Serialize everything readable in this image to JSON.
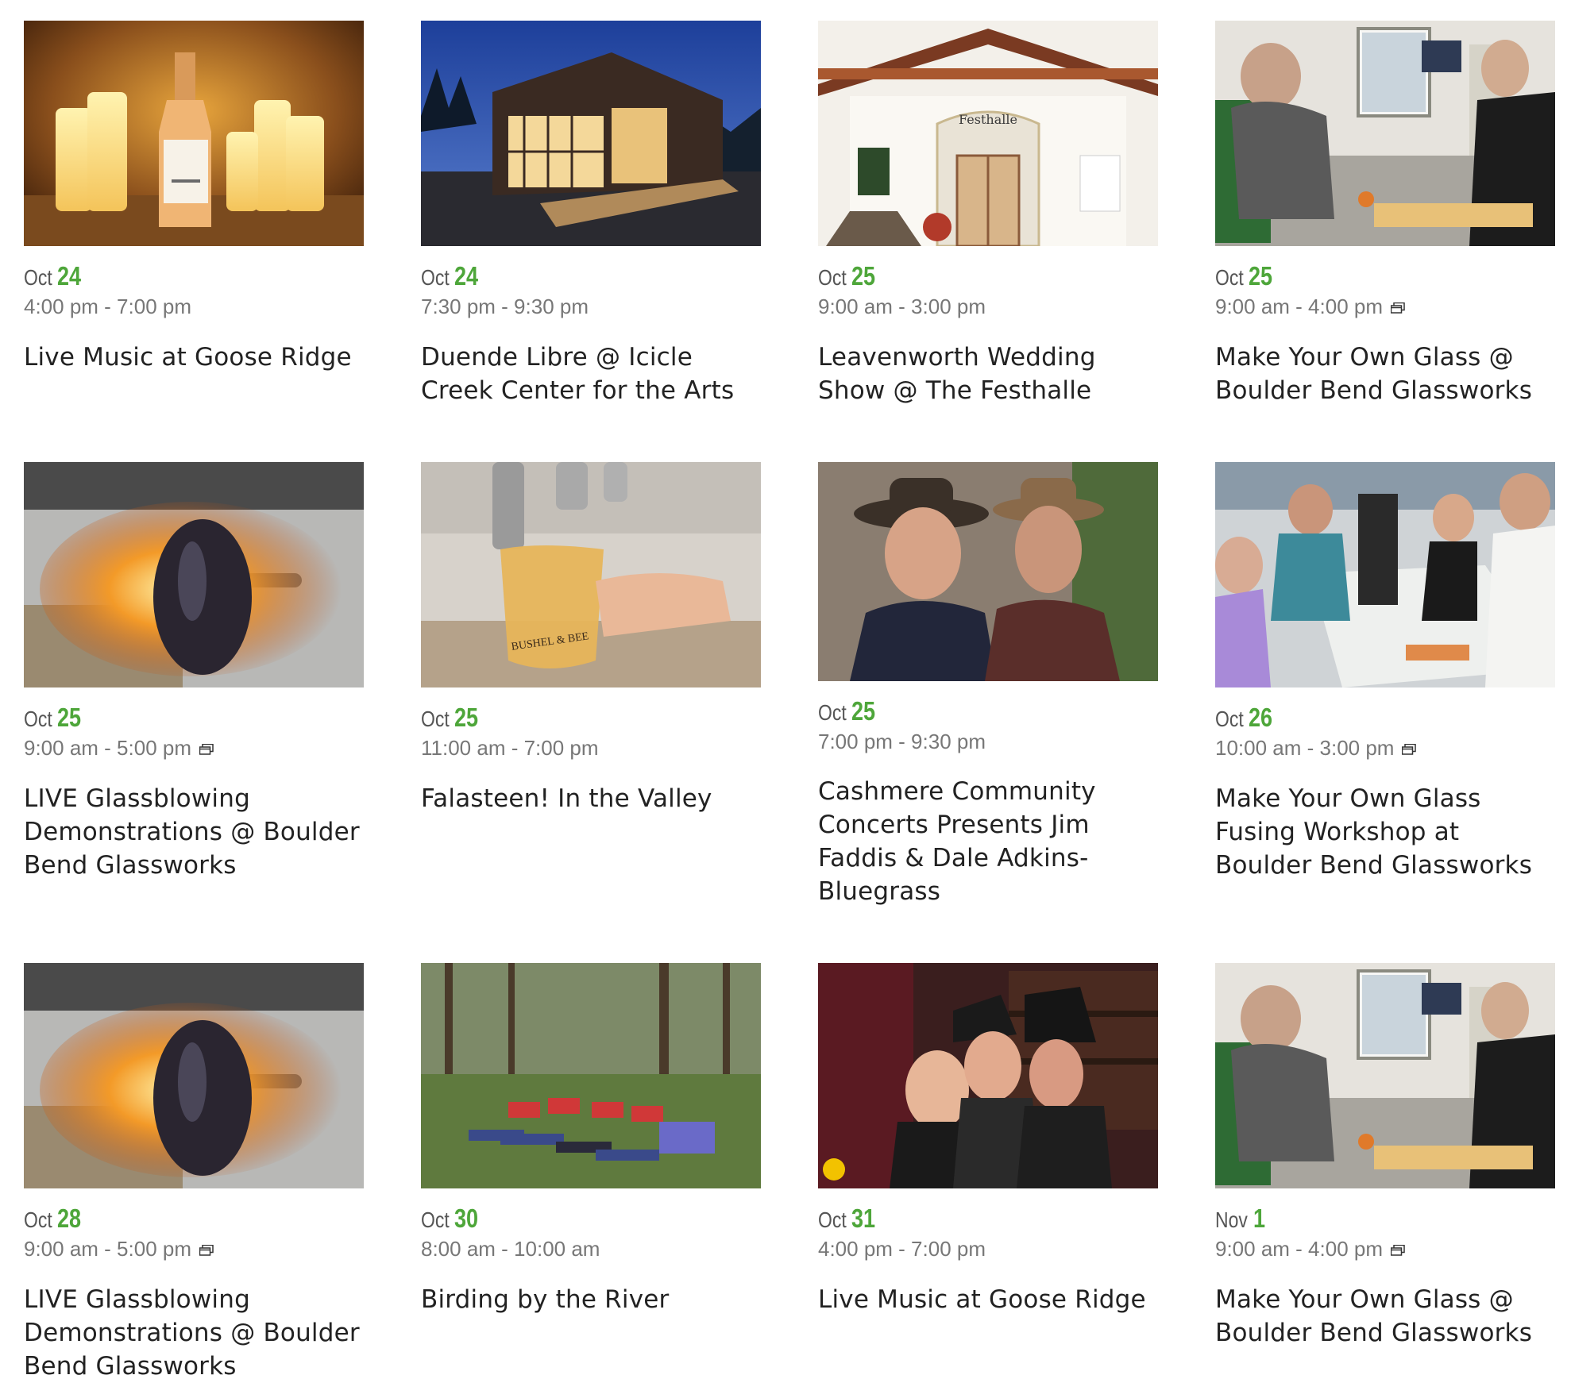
{
  "events": [
    {
      "month": "Oct",
      "day": "24",
      "time": "4:00 pm - 7:00 pm",
      "recurring": false,
      "title": "Live Music at Goose Ridge",
      "image_icon": "wine-bottle-candles-photo"
    },
    {
      "month": "Oct",
      "day": "24",
      "time": "7:30 pm - 9:30 pm",
      "recurring": false,
      "title": "Duende Libre @ Icicle Creek Center for the Arts",
      "image_icon": "arts-center-building-photo"
    },
    {
      "month": "Oct",
      "day": "25",
      "time": "9:00 am - 3:00 pm",
      "recurring": false,
      "title": "Leavenworth Wedding Show @ The Festhalle",
      "image_icon": "festhalle-building-photo",
      "sign_text": "Festhalle"
    },
    {
      "month": "Oct",
      "day": "25",
      "time": "9:00 am - 4:00 pm",
      "recurring": true,
      "title": "Make Your Own Glass @ Boulder Bend Glassworks",
      "image_icon": "glass-workshop-photo"
    },
    {
      "month": "Oct",
      "day": "25",
      "time": "9:00 am - 5:00 pm",
      "recurring": true,
      "title": "LIVE Glassblowing Demonstrations @ Boulder Bend Glassworks",
      "image_icon": "glassblowing-fire-photo"
    },
    {
      "month": "Oct",
      "day": "25",
      "time": "11:00 am - 7:00 pm",
      "recurring": false,
      "title": "Falasteen! In the Valley",
      "image_icon": "beer-tap-glass-photo",
      "glass_text": "BUSHEL & BEE"
    },
    {
      "month": "Oct",
      "day": "25",
      "time": "7:00 pm - 9:30 pm",
      "recurring": false,
      "title": "Cashmere Community Concerts Presents Jim Faddis & Dale Adkins- Bluegrass",
      "image_icon": "musicians-portrait-photo"
    },
    {
      "month": "Oct",
      "day": "26",
      "time": "10:00 am - 3:00 pm",
      "recurring": true,
      "title": "Make Your Own Glass Fusing Workshop at Boulder Bend Glassworks",
      "image_icon": "glass-fusing-class-photo"
    },
    {
      "month": "Oct",
      "day": "28",
      "time": "9:00 am - 5:00 pm",
      "recurring": true,
      "title": "LIVE Glassblowing Demonstrations @ Boulder Bend Glassworks",
      "image_icon": "glassblowing-fire-photo"
    },
    {
      "month": "Oct",
      "day": "30",
      "time": "8:00 am - 10:00 am",
      "recurring": false,
      "title": "Birding by the River",
      "image_icon": "kids-birding-photo"
    },
    {
      "month": "Oct",
      "day": "31",
      "time": "4:00 pm - 7:00 pm",
      "recurring": false,
      "title": "Live Music at Goose Ridge",
      "image_icon": "witches-wine-bar-photo"
    },
    {
      "month": "Nov",
      "day": "1",
      "time": "9:00 am - 4:00 pm",
      "recurring": true,
      "title": "Make Your Own Glass @ Boulder Bend Glassworks",
      "image_icon": "glass-workshop-photo"
    }
  ],
  "colors": {
    "day_accent": "#4ea63a",
    "month_text": "#555555",
    "time_text": "#777777",
    "title_text": "#222222"
  }
}
